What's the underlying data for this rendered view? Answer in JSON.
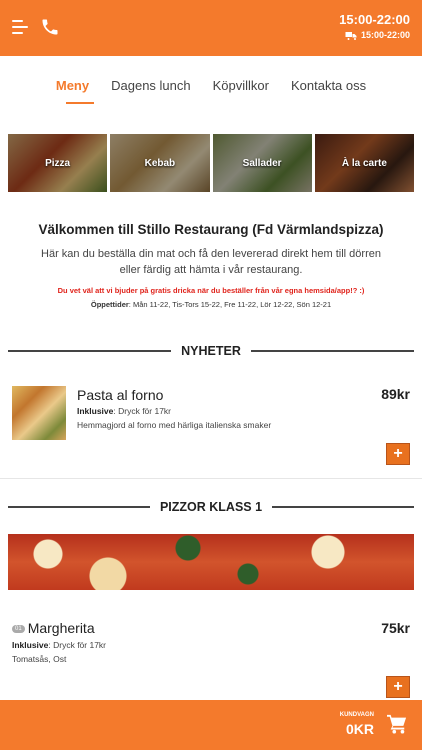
{
  "header": {
    "hours": "15:00-22:00",
    "delivery_hours": "15:00-22:00"
  },
  "tabs": [
    {
      "label": "Meny"
    },
    {
      "label": "Dagens lunch"
    },
    {
      "label": "Köpvillkor"
    },
    {
      "label": "Kontakta oss"
    }
  ],
  "categories": [
    {
      "label": "Pizza"
    },
    {
      "label": "Kebab"
    },
    {
      "label": "Sallader"
    },
    {
      "label": "À la carte"
    }
  ],
  "welcome": {
    "title": "Välkommen till Stillo Restaurang (Fd Värmlandspizza)",
    "intro": "Här kan du beställa din mat och få den levererad direkt hem till dörren eller färdig att hämta i vår restaurang.",
    "promo": "Du vet väl att vi bjuder på gratis dricka när du beställer från vår egna hemsida/app!? :)",
    "opening_label": "Öppettider",
    "opening_hours": ": Mån 11-22, Tis-Tors 15-22, Fre 11-22, Lör 12-22, Sön 12-21"
  },
  "sections": [
    {
      "title": "NYHETER",
      "items": [
        {
          "name": "Pasta al forno",
          "price": "89kr",
          "inclusive_label": "Inklusive",
          "inclusive_text": ": Dryck för 17kr",
          "description": "Hemmagjord al forno med härliga italienska smaker",
          "add": "+"
        }
      ]
    },
    {
      "title": "PIZZOR KLASS 1",
      "items": [
        {
          "number": "01",
          "name": "Margherita",
          "price": "75kr",
          "inclusive_label": "Inklusive",
          "inclusive_text": ": Dryck för 17kr",
          "description": "Tomatsås, Ost",
          "add": "+"
        }
      ]
    }
  ],
  "cart": {
    "label": "KUNDVAGN",
    "total": "0KR"
  },
  "colors": {
    "accent": "#f47a2c",
    "promo": "#e0241c"
  }
}
